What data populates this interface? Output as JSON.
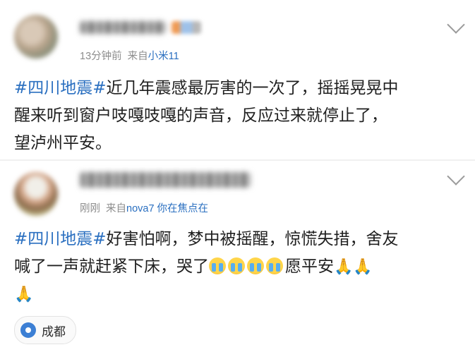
{
  "posts": [
    {
      "time": "13分钟前",
      "source_prefix": "来自",
      "device": "小米11",
      "hashtag": "#四川地震#",
      "lines": [
        "近几年震感最厉害的一次了，摇摇晃晃中",
        "醒来听到窗户吱嘎吱嘎的声音，反应过来就停止了，",
        "望泸州平安。"
      ]
    },
    {
      "time": "刚刚",
      "source_prefix": "来自",
      "device": "nova7 你在焦点在",
      "hashtag": "#四川地震#",
      "lines": [
        "好害怕啊，梦中被摇醒，惊慌失措，舍友",
        "喊了一声就赶紧下床，哭了",
        "愿平安"
      ],
      "emojis": [
        "crying-face",
        "crying-face",
        "crying-face",
        "crying-face",
        "praying-hands",
        "praying-hands",
        "praying-hands"
      ]
    }
  ],
  "location": {
    "label": "成都",
    "icon": "location-pin-icon",
    "color": "#3c7fd4"
  },
  "colors": {
    "link": "#2a6fc0",
    "meta": "#8d8d8d",
    "text": "#1f1f1f"
  }
}
